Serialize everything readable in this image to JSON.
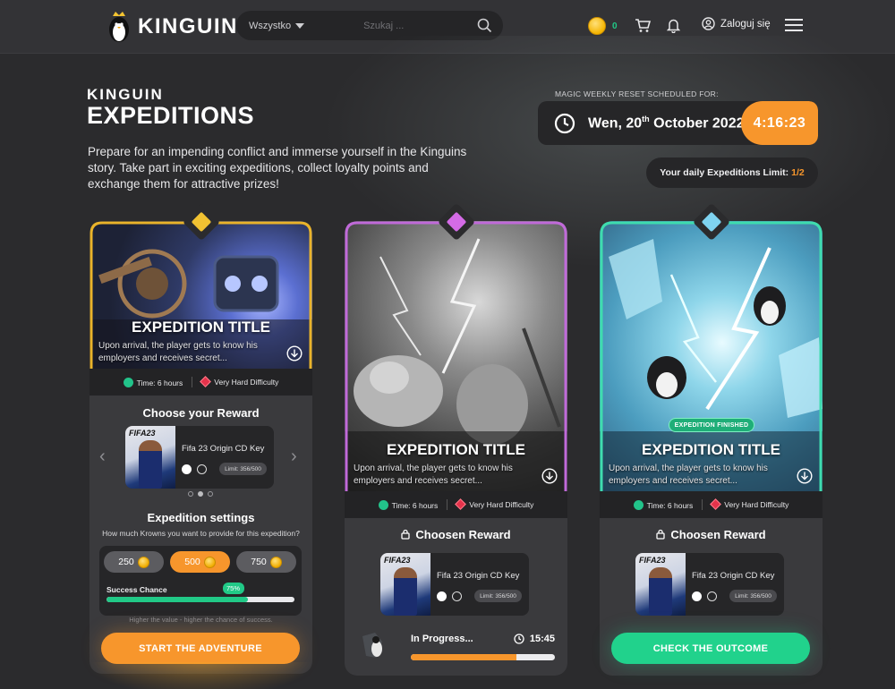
{
  "header": {
    "logo_text": "KINGUIN",
    "search_category": "Wszystko",
    "search_placeholder": "Szukaj ...",
    "coins": "0",
    "login_label": "Zaloguj się"
  },
  "hero": {
    "brand_small": "KINGUIN",
    "brand_big": "EXPEDITIONS",
    "intro": "Prepare for an impending conflict and immerse yourself in the Kinguins story. Take part in exciting expeditions, collect loyalty points and exchange them for attractive prizes!",
    "reset_label": "MAGIC WEEKLY RESET SCHEDULED FOR:",
    "reset_date_prefix": "Wen, 20",
    "reset_date_sup": "th",
    "reset_date_suffix": " October 2022",
    "reset_timer": "4:16:23",
    "limit_label": "Your daily Expeditions Limit:",
    "limit_value": "1/2"
  },
  "colors": {
    "accent_orange": "#f7962c",
    "accent_green": "#21d28c",
    "gold_frame": "#e9b32a",
    "purple_frame": "#c06ad9",
    "teal_frame": "#3fdcae"
  },
  "cards": [
    {
      "title": "EXPEDITION TITLE",
      "desc": "Upon arrival, the player gets to know his employers and receives secret...",
      "time": "Time: 6 hours",
      "difficulty": "Very Hard Difficulty",
      "reward_heading": "Choose your Reward",
      "reward_name": "Fifa 23 Origin CD Key",
      "reward_badge": "FIFA23",
      "reward_limit": "Limit: 356/500",
      "settings_title": "Expedition settings",
      "krowns_question": "How much Krowns you want to provide for this expedition?",
      "amounts": [
        "250",
        "500",
        "750"
      ],
      "selected_amount_index": 1,
      "success_label": "Success Chance",
      "success_value": "75%",
      "success_fraction": 0.75,
      "hint": "Higher the value - higher the chance of success.",
      "button": "START THE ADVENTURE"
    },
    {
      "title": "EXPEDITION TITLE",
      "desc": "Upon arrival, the player gets to know his employers and receives secret...",
      "time": "Time: 6 hours",
      "difficulty": "Very Hard Difficulty",
      "reward_heading": "Choosen Reward",
      "reward_name": "Fifa 23 Origin CD Key",
      "reward_badge": "FIFA23",
      "reward_limit": "Limit: 356/500",
      "progress_label": "In Progress...",
      "progress_time": "15:45",
      "progress_fraction": 0.73
    },
    {
      "title": "EXPEDITION TITLE",
      "badge": "EXPEDITION FINISHED",
      "desc": "Upon arrival, the player gets to know his employers and receives secret...",
      "time": "Time: 6 hours",
      "difficulty": "Very Hard Difficulty",
      "reward_heading": "Choosen Reward",
      "reward_name": "Fifa 23 Origin CD Key",
      "reward_badge": "FIFA23",
      "reward_limit": "Limit: 356/500",
      "button": "CHECK THE OUTCOME"
    }
  ]
}
